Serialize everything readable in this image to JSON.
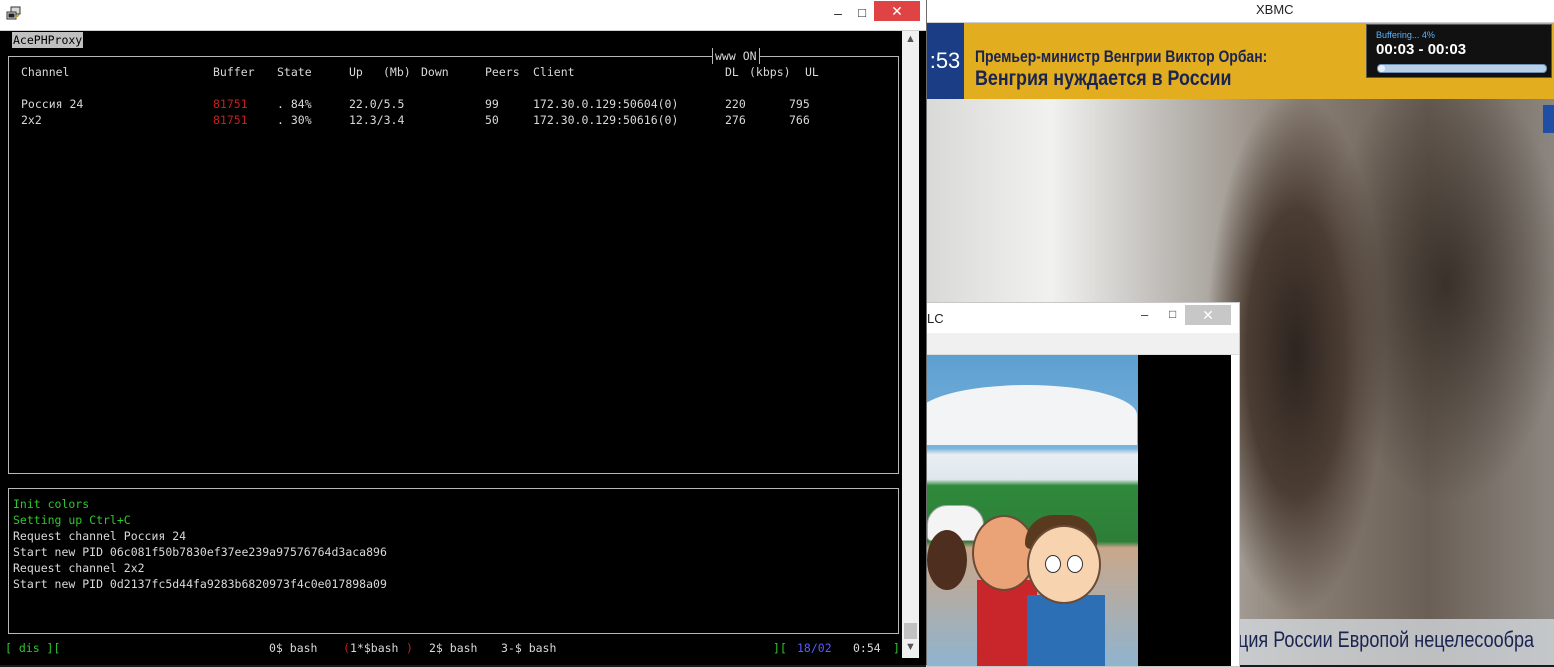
{
  "xbmc": {
    "title": "XBMC",
    "clock_text": ":53",
    "ticker_line1": "Премьер-министр Венгрии Виктор Орбан:",
    "ticker_line2": "Венгрия нуждается в России",
    "buffering_label": "Buffering... 4%",
    "buffering_percent": 4,
    "time_range": "00:03 - 00:03",
    "bottom_ticker": "ция России Европой нецелесообра"
  },
  "vlc": {
    "title_fragment": "LC",
    "minimize_glyph": "–",
    "maximize_glyph": "□",
    "close_glyph": "✕"
  },
  "terminal": {
    "window": {
      "minimize_glyph": "–",
      "maximize_glyph": "□",
      "close_glyph": "✕"
    },
    "app_name": "AcePHProxy",
    "www_status": "www ON",
    "headers": {
      "channel": "Channel",
      "buffer": "Buffer",
      "state": "State",
      "up": "Up",
      "mb": "(Mb)",
      "down": "Down",
      "peers": "Peers",
      "client": "Client",
      "dl": "DL",
      "kbps": "(kbps)",
      "ul": "UL"
    },
    "channels": [
      {
        "name": "Россия 24",
        "buffer": "81751",
        "state": ". 84%",
        "updown": "22.0/5.5",
        "peers": "99",
        "client": "172.30.0.129:50604(0)",
        "dl": "220",
        "ul": "795"
      },
      {
        "name": "2x2",
        "buffer": "81751",
        "state": ". 30%",
        "updown": "12.3/3.4",
        "peers": "50",
        "client": "172.30.0.129:50616(0)",
        "dl": "276",
        "ul": "766"
      }
    ],
    "log": [
      {
        "text": "Init colors",
        "color": "#2ec72e"
      },
      {
        "text": "Setting up Ctrl+C",
        "color": "#2ec72e"
      },
      {
        "text": "Request channel Россия 24",
        "color": "#d9d9d9"
      },
      {
        "text": "Start new PID 06c081f50b7830ef37ee239a97576764d3aca896",
        "color": "#d9d9d9"
      },
      {
        "text": "Request channel 2x2",
        "color": "#d9d9d9"
      },
      {
        "text": "Start new PID 0d2137fc5d44fa9283b6820973f4c0e017898a09",
        "color": "#d9d9d9"
      }
    ],
    "status_bar": {
      "left": "[ dis ][",
      "win0": "0$ bash",
      "win1_open": "(",
      "win1": "1*$bash",
      "win1_close": ")",
      "win2": "2$ bash",
      "win3": "3-$ bash",
      "right_bracket": "][",
      "date": "18/02",
      "time": "0:54",
      "end": "]"
    }
  }
}
